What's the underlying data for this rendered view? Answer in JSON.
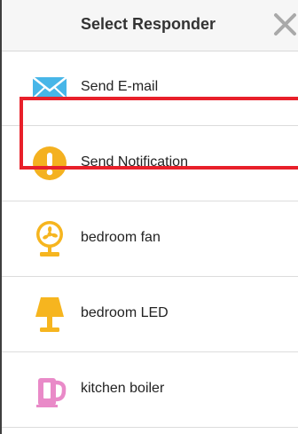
{
  "dialog": {
    "title": "Select Responder",
    "close_icon": "close-x-icon"
  },
  "responders": [
    {
      "label": "Send E-mail",
      "icon": "envelope-icon",
      "color": "#47b6e8"
    },
    {
      "label": "Send Notification",
      "icon": "exclamation-circle-icon",
      "color": "#f4b120"
    },
    {
      "label": "bedroom fan",
      "icon": "fan-icon",
      "color": "#f6b51f"
    },
    {
      "label": "bedroom LED",
      "icon": "lamp-icon",
      "color": "#f6b51f"
    },
    {
      "label": "kitchen boiler",
      "icon": "kettle-icon",
      "color": "#e98ac8"
    }
  ],
  "selected_responder": "Send Notification",
  "highlight_color": "#e8202a"
}
